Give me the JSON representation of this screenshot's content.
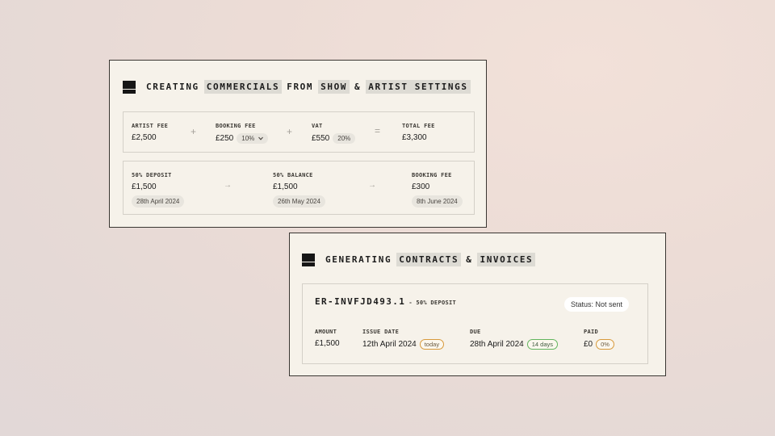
{
  "commercials_card": {
    "heading": [
      {
        "text": "CREATING",
        "highlight": false
      },
      {
        "text": "COMMERCIALS",
        "highlight": true
      },
      {
        "text": "FROM",
        "highlight": false
      },
      {
        "text": "SHOW",
        "highlight": true
      },
      {
        "text": "&",
        "highlight": false
      },
      {
        "text": "ARTIST SETTINGS",
        "highlight": true
      }
    ],
    "fees": {
      "artist_fee": {
        "label": "ARTIST FEE",
        "value": "£2,500"
      },
      "op1": "+",
      "booking_fee": {
        "label": "BOOKING FEE",
        "value": "£250",
        "pill": "10%",
        "pill_icon": "chevron-down-icon"
      },
      "op2": "+",
      "vat": {
        "label": "VAT",
        "value": "£550",
        "pill": "20%"
      },
      "op3": "=",
      "total_fee": {
        "label": "TOTAL FEE",
        "value": "£3,300"
      }
    },
    "schedule": {
      "deposit": {
        "label": "50% DEPOSIT",
        "value": "£1,500",
        "date": "28th April 2024"
      },
      "arrow1": "→",
      "balance": {
        "label": "50% BALANCE",
        "value": "£1,500",
        "date": "26th May 2024"
      },
      "arrow2": "→",
      "booking_fee": {
        "label": "BOOKING FEE",
        "value": "£300",
        "date": "8th June 2024"
      }
    }
  },
  "contracts_card": {
    "heading": [
      {
        "text": "GENERATING",
        "highlight": false
      },
      {
        "text": "CONTRACTS",
        "highlight": true
      },
      {
        "text": "&",
        "highlight": false
      },
      {
        "text": "INVOICES",
        "highlight": true
      }
    ],
    "invoice": {
      "id": "ER-INVFJD493.1",
      "subtitle": "- 50% DEPOSIT",
      "status": "Status: Not sent",
      "amount": {
        "label": "AMOUNT",
        "value": "£1,500"
      },
      "issue_date": {
        "label": "ISSUE DATE",
        "value": "12th April 2024",
        "tag": "today"
      },
      "due": {
        "label": "DUE",
        "value": "28th April 2024",
        "tag": "14 days"
      },
      "paid": {
        "label": "PAID",
        "value": "£0",
        "tag": "0%"
      }
    }
  },
  "colors": {
    "card_bg": "#f6f2ea",
    "highlight": "#dddbd4",
    "tag_orange": "#d89a3c",
    "tag_green": "#62b55e"
  }
}
